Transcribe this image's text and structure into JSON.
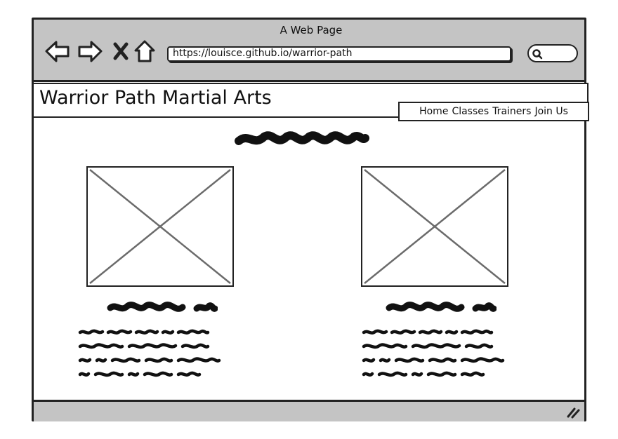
{
  "browser": {
    "window_title": "A Web Page",
    "url": "https://louisce.github.io/warrior-path",
    "icons": {
      "back": "back-arrow-icon",
      "forward": "forward-arrow-icon",
      "close": "close-icon",
      "home": "home-icon",
      "search": "search-icon",
      "resize": "resize-grip-icon"
    }
  },
  "site": {
    "title": "Warrior Path Martial Arts",
    "nav": {
      "home": "Home",
      "classes": "Classes",
      "trainers": "Trainers",
      "join": "Join Us"
    }
  },
  "colors": {
    "chrome_gray": "#c4c4c4",
    "ink": "#222222",
    "placeholder_line": "#6b6b6b"
  }
}
